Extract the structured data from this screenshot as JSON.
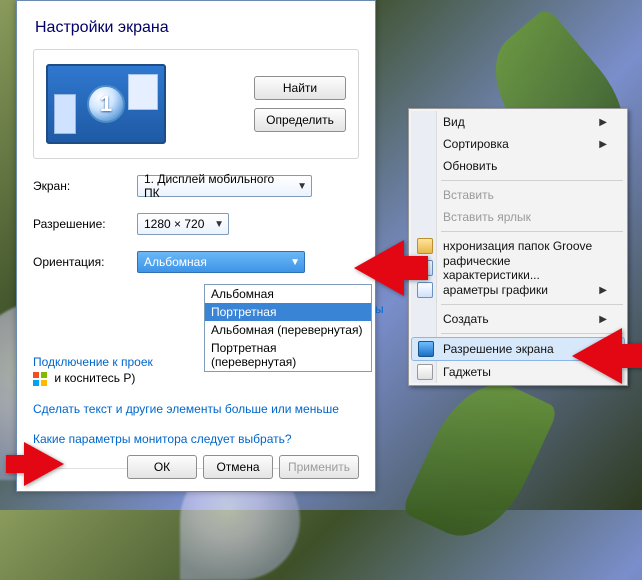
{
  "dialog": {
    "title": "Настройки экрана",
    "btn_find": "Найти",
    "btn_detect": "Определить",
    "monitor_number": "1",
    "screen": {
      "label": "Экран:",
      "value": "1. Дисплей мобильного ПК"
    },
    "resolution": {
      "label": "Разрешение:",
      "value": "1280 × 720"
    },
    "orientation": {
      "label": "Ориентация:",
      "value": "Альбомная",
      "options": [
        "Альбомная",
        "Портретная",
        "Альбомная (перевернутая)",
        "Портретная (перевернутая)"
      ],
      "highlighted": "Портретная"
    },
    "truncated_hint_char": "ы",
    "link_project": "Подключение к проек",
    "project_sub": "и коснитесь P)",
    "link_textsize": "Сделать текст и другие элементы больше или меньше",
    "link_which": "Какие параметры монитора следует выбрать?",
    "btn_ok": "ОК",
    "btn_cancel": "Отмена",
    "btn_apply": "Применить"
  },
  "ctx": {
    "view": "Вид",
    "sort": "Сортировка",
    "refresh": "Обновить",
    "paste": "Вставить",
    "paste_shortcut": "Вставить ярлык",
    "groove": "нхронизация папок Groove",
    "gfx_props": "рафические характеристики...",
    "gfx_params": "араметры графики",
    "create": "Создать",
    "resolution": "Разрешение экрана",
    "gadgets": "Гаджеты"
  }
}
